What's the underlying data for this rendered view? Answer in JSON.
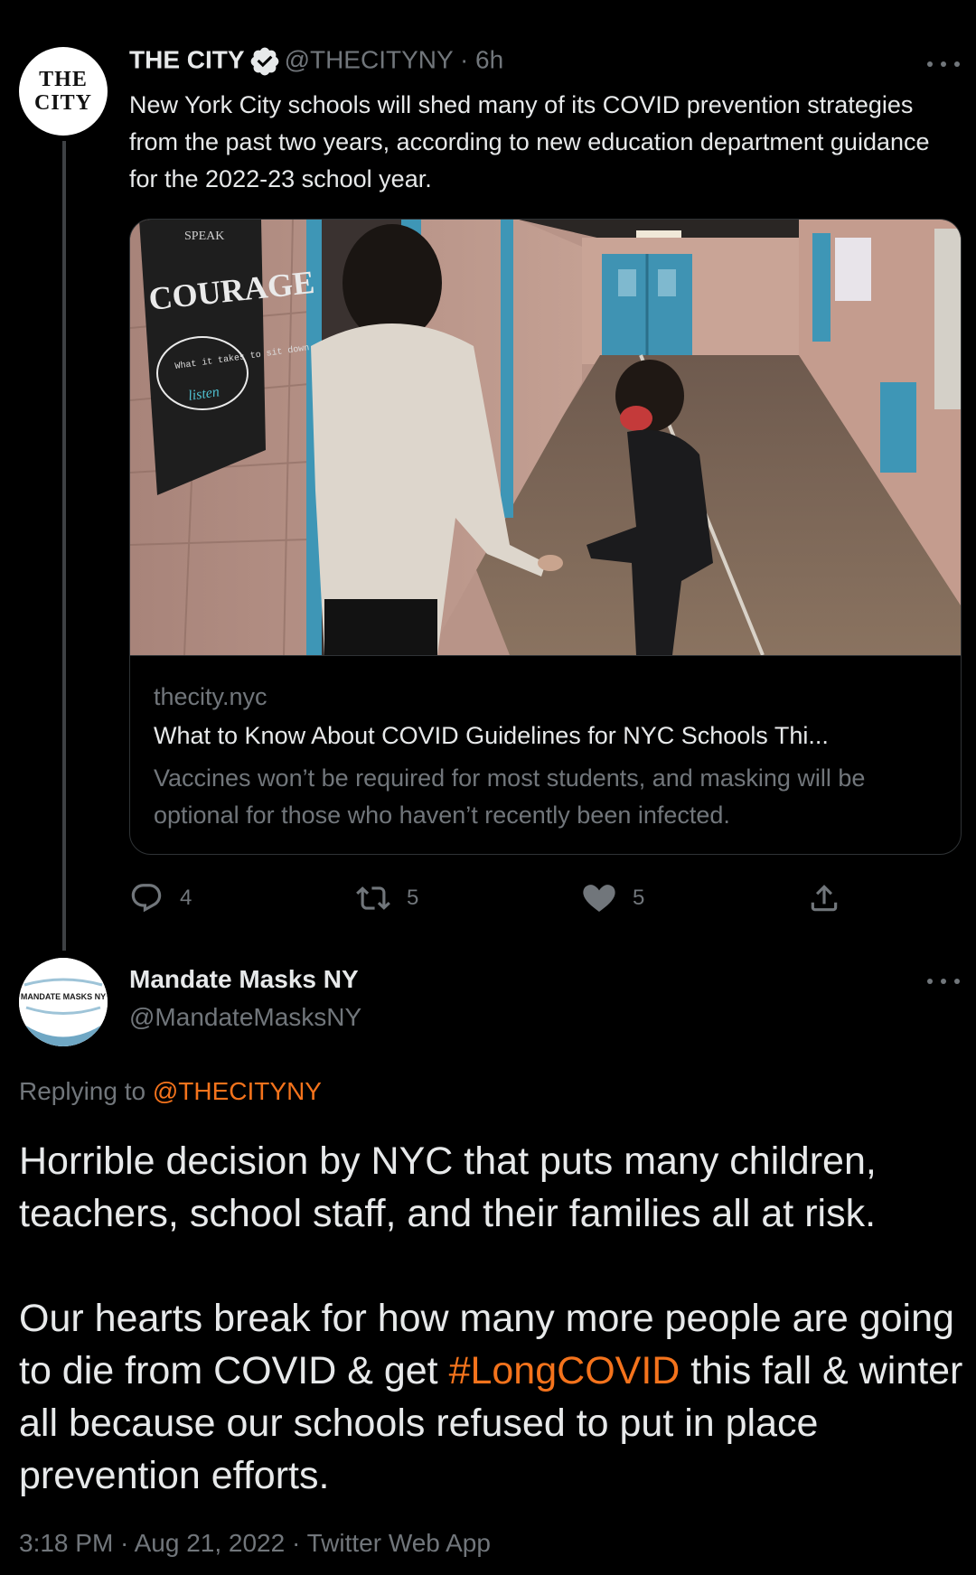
{
  "tweet1": {
    "name": "THE CITY",
    "handle": "@THECITYNY",
    "separator": "·",
    "time": "6h",
    "avatar_text_1": "THE",
    "avatar_text_2": "CITY",
    "text": "New York City schools will shed many of its COVID prevention strategies from the past two years, according to new education department guidance for the 2022-23 school year.",
    "card": {
      "domain": "thecity.nyc",
      "title": "What to Know About COVID Guidelines for NYC Schools Thi...",
      "description": "Vaccines won’t be required for most students, and masking will be optional for those who haven’t recently been infected.",
      "image_sign_top": "SPEAK",
      "image_sign_main": "COURAGE",
      "image_sign_small": "What it takes to sit down and",
      "image_sign_script": "listen"
    },
    "actions": {
      "replies": "4",
      "retweets": "5",
      "likes": "5"
    }
  },
  "tweet2": {
    "name": "Mandate Masks NY",
    "handle": "@MandateMasksNY",
    "avatar_text": "MANDATE MASKS NY",
    "replying_prefix": "Replying to ",
    "replying_mention": "@THECITYNY",
    "para1": "Horrible decision by NYC that puts many children, teachers, school staff, and their families all at risk.",
    "para2_before": "Our hearts break for how many more people are going to die from COVID & get ",
    "para2_hashtag": "#LongCOVID",
    "para2_after": " this fall & winter all because our schools refused to put in place prevention efforts.",
    "meta": "3:18 PM · Aug 21, 2022 · Twitter Web App"
  },
  "colors": {
    "background": "#000000",
    "text": "#e7e9ea",
    "secondary": "#71767b",
    "accent": "#f4731c",
    "divider": "#2f3336"
  }
}
